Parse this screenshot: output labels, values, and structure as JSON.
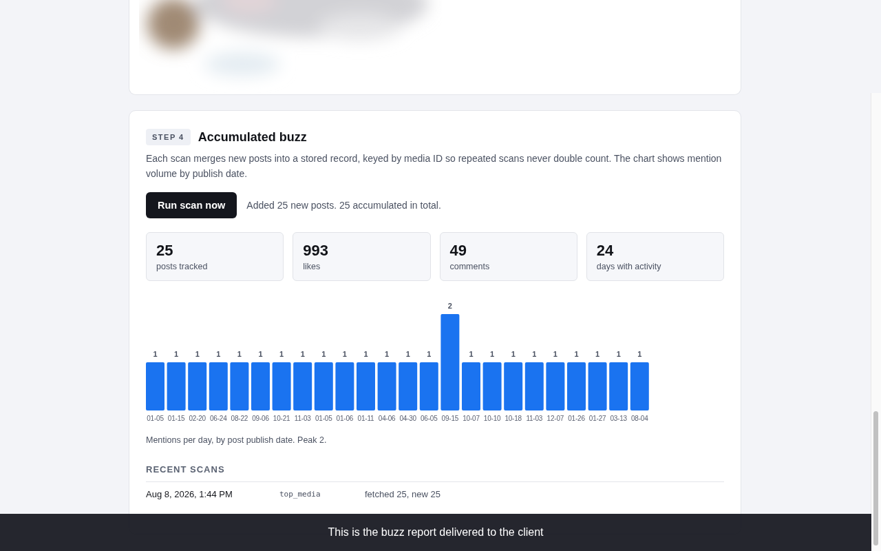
{
  "step": {
    "badge": "STEP 4",
    "title": "Accumulated buzz",
    "description": "Each scan merges new posts into a stored record, keyed by media ID so repeated scans never double count. The chart shows mention volume by publish date.",
    "action": {
      "button": "Run scan now",
      "result": "Added 25 new posts. 25 accumulated in total."
    },
    "stats": [
      {
        "value": "25",
        "label": "posts tracked"
      },
      {
        "value": "993",
        "label": "likes"
      },
      {
        "value": "49",
        "label": "comments"
      },
      {
        "value": "24",
        "label": "days with activity"
      }
    ],
    "chart_data": {
      "type": "bar",
      "categories": [
        "01-05",
        "01-15",
        "02-20",
        "06-24",
        "08-22",
        "09-06",
        "10-21",
        "11-03",
        "01-05",
        "01-06",
        "01-11",
        "04-06",
        "04-30",
        "06-05",
        "09-15",
        "10-07",
        "10-10",
        "10-18",
        "11-03",
        "12-07",
        "01-26",
        "01-27",
        "03-13",
        "08-04"
      ],
      "series": [
        {
          "color": "#1a73f0",
          "values": [
            1,
            1,
            1,
            1,
            1,
            1,
            1,
            1,
            1,
            1,
            1,
            1,
            1,
            1,
            2,
            1,
            1,
            1,
            1,
            1,
            1,
            1,
            1,
            1
          ]
        }
      ],
      "data_labels": true
    },
    "chart_caption": "Mentions per day, by post publish date. Peak 2.",
    "recent_scans": {
      "heading": "RECENT SCANS",
      "rows": [
        {
          "time": "Aug 8, 2026, 1:44 PM",
          "source": "top_media",
          "result": "fetched 25, new 25"
        }
      ]
    }
  },
  "caption_overlay": "This is the buzz report delivered to the client"
}
